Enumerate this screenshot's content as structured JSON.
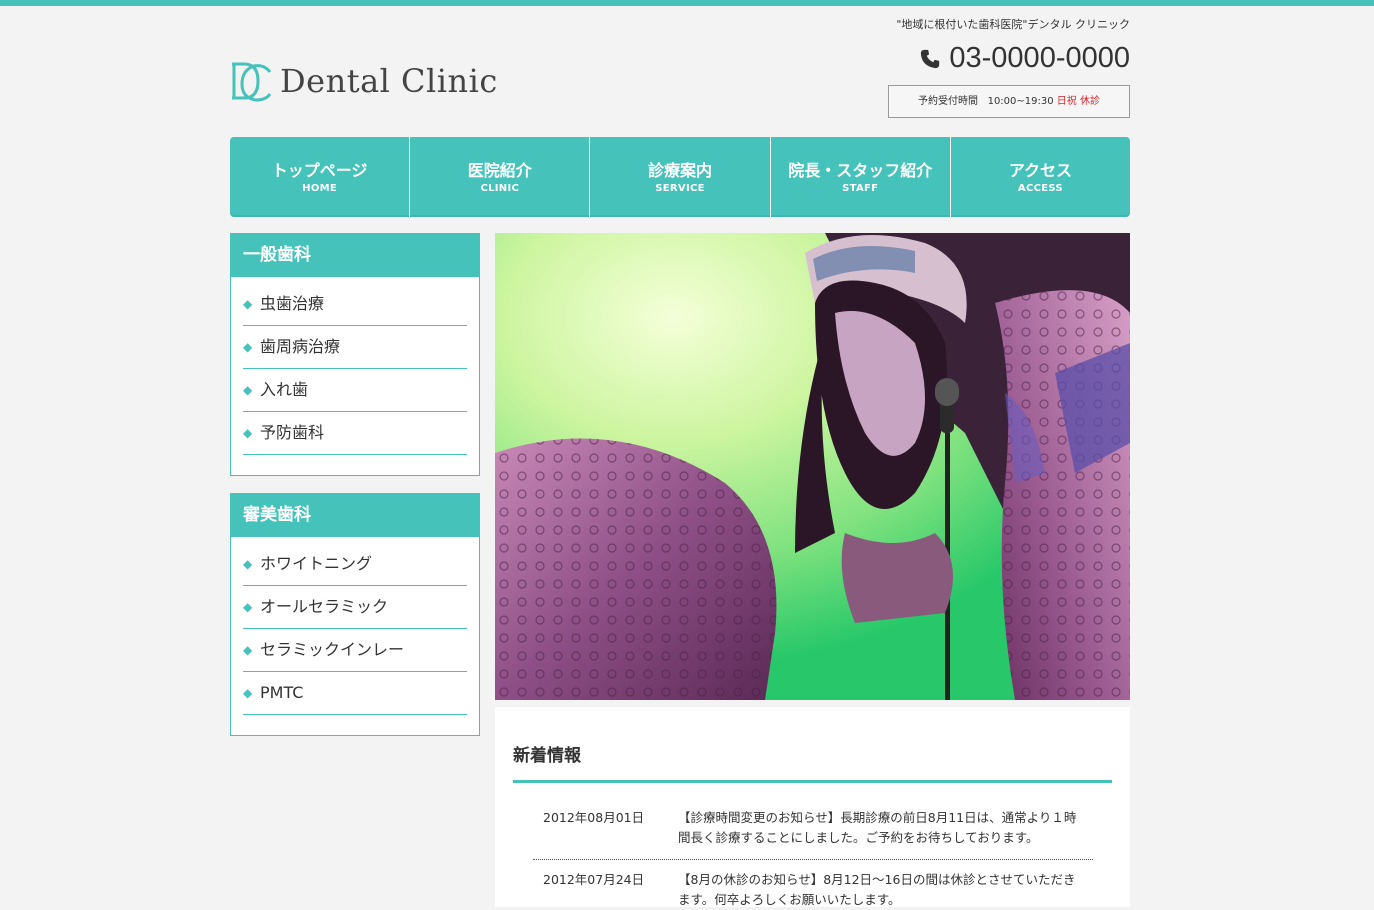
{
  "header": {
    "tagline": "\"地域に根付いた歯科医院\"デンタル クリニック",
    "logo_text": "Dental Clinic",
    "phone": "03-0000-0000",
    "hours_label": "予約受付時間",
    "hours_time": "10:00~19:30",
    "hours_closed": "日祝 休診"
  },
  "nav": {
    "items": [
      {
        "label": "トップページ",
        "sub": "HOME"
      },
      {
        "label": "医院紹介",
        "sub": "CLINIC"
      },
      {
        "label": "診療案内",
        "sub": "SERVICE"
      },
      {
        "label": "院長・スタッフ紹介",
        "sub": "STAFF"
      },
      {
        "label": "アクセス",
        "sub": "ACCESS"
      }
    ]
  },
  "sidebar": {
    "general": {
      "title": "一般歯科",
      "items": [
        "虫歯治療",
        "歯周病治療",
        "入れ歯",
        "予防歯科"
      ]
    },
    "cosmetic": {
      "title": "審美歯科",
      "items": [
        "ホワイトニング",
        "オールセラミック",
        "セラミックインレー",
        "PMTC"
      ]
    }
  },
  "news": {
    "title": "新着情報",
    "items": [
      {
        "date": "2012年08月01日",
        "text": "【診療時間変更のお知らせ】長期診療の前日8月11日は、通常より１時間長く診療することにしました。ご予約をお待ちしております。"
      },
      {
        "date": "2012年07月24日",
        "text": "【8月の休診のお知らせ】8月12日〜16日の間は休診とさせていただきます。何卒よろしくお願いいたします。"
      }
    ]
  },
  "colors": {
    "accent": "#45c2b9",
    "closed": "#d4262d",
    "background": "#f3f3f3"
  }
}
